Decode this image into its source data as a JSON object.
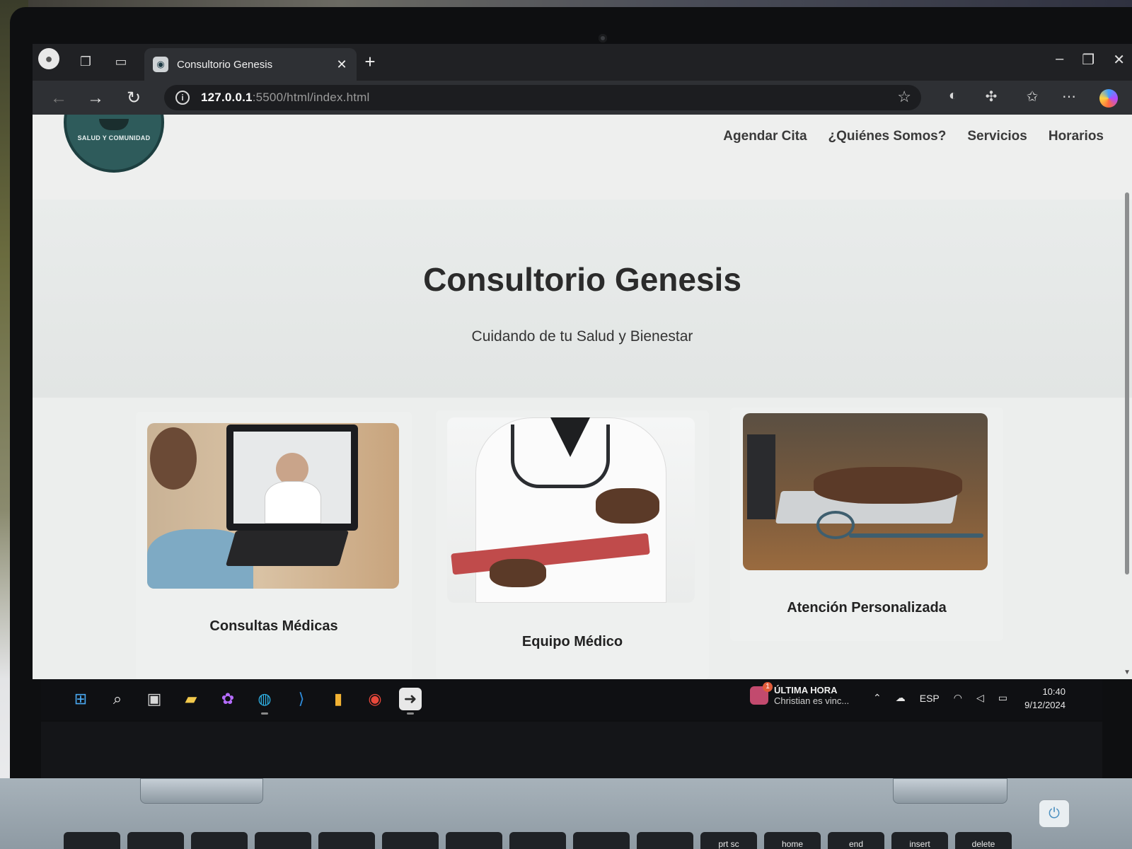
{
  "browser": {
    "tab_title": "Consultorio Genesis",
    "tab_close": "✕",
    "new_tab": "+",
    "url_host": "127.0.0.1",
    "url_rest": ":5500/html/index.html",
    "icons": [
      "profile-icon",
      "workspaces-icon",
      "vertical-tabs-icon",
      "back-icon",
      "forward-icon",
      "refresh-icon",
      "info-icon",
      "favorite-star-icon",
      "extension-icon",
      "extensions-puzzle-icon",
      "favorites-icon",
      "more-icon",
      "copilot-icon"
    ]
  },
  "site": {
    "logo_text": "SALUD Y COMUNIDAD",
    "nav": [
      "Agendar Cita",
      "¿Quiénes Somos?",
      "Servicios",
      "Horarios"
    ],
    "hero_title": "Consultorio Genesis",
    "hero_subtitle": "Cuidando de tu Salud y Bienestar",
    "cards": [
      {
        "title": "Consultas Médicas"
      },
      {
        "title": "Equipo Médico"
      },
      {
        "title": "Atención Personalizada"
      }
    ]
  },
  "taskbar": {
    "news_title": "ÚLTIMA HORA",
    "news_subtitle": "Christian es vinc...",
    "news_badge": "1",
    "language": "ESP",
    "time": "10:40",
    "date": "9/12/2024"
  },
  "keyboard": {
    "keys": [
      "",
      "",
      "",
      "",
      "",
      "",
      "",
      "",
      "",
      "",
      "prt sc",
      "home",
      "end",
      "insert",
      "delete",
      ""
    ]
  },
  "colors": {
    "page_bg": "#eceeed",
    "logo_teal": "#2e5b5b",
    "browser_dark": "#202124",
    "taskbar_dark": "#0f1013"
  }
}
